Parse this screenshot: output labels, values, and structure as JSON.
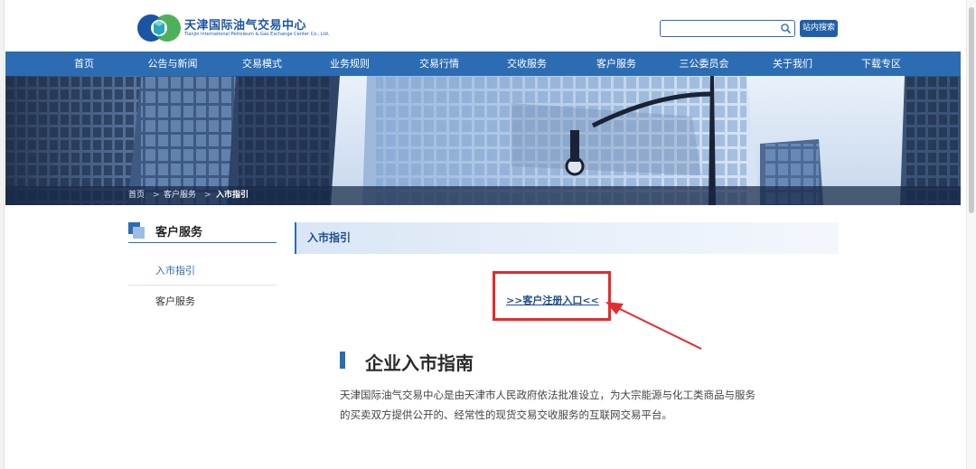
{
  "header": {
    "logo_cn": "天津国际油气交易中心",
    "logo_en": "Tianjin International Petroleum & Gas Exchange Center Co., Ltd.",
    "search_placeholder": "",
    "search_button": "站内搜索"
  },
  "nav": {
    "items": [
      {
        "label": "首页"
      },
      {
        "label": "公告与新闻"
      },
      {
        "label": "交易模式"
      },
      {
        "label": "业务规则"
      },
      {
        "label": "交易行情"
      },
      {
        "label": "交收服务"
      },
      {
        "label": "客户服务"
      },
      {
        "label": "三公委员会"
      },
      {
        "label": "关于我们"
      },
      {
        "label": "下载专区"
      }
    ]
  },
  "breadcrumb": {
    "items": [
      "首页",
      "客户服务",
      "入市指引"
    ],
    "separator": ">"
  },
  "sidebar": {
    "title": "客户服务",
    "items": [
      {
        "label": "入市指引",
        "active": true
      },
      {
        "label": "客户服务",
        "active": false
      }
    ]
  },
  "content": {
    "heading": "入市指引",
    "register_link": ">>客户注册入口<<",
    "guide_title": "企业入市指南",
    "guide_text": "天津国际油气交易中心是由天津市人民政府依法批准设立，为大宗能源与化工类商品与服务的买卖双方提供公开的、经常性的现货交易交收服务的互联网交易平台。"
  },
  "colors": {
    "brand_blue": "#2c6cb3",
    "highlight_red": "#e52b2b"
  }
}
